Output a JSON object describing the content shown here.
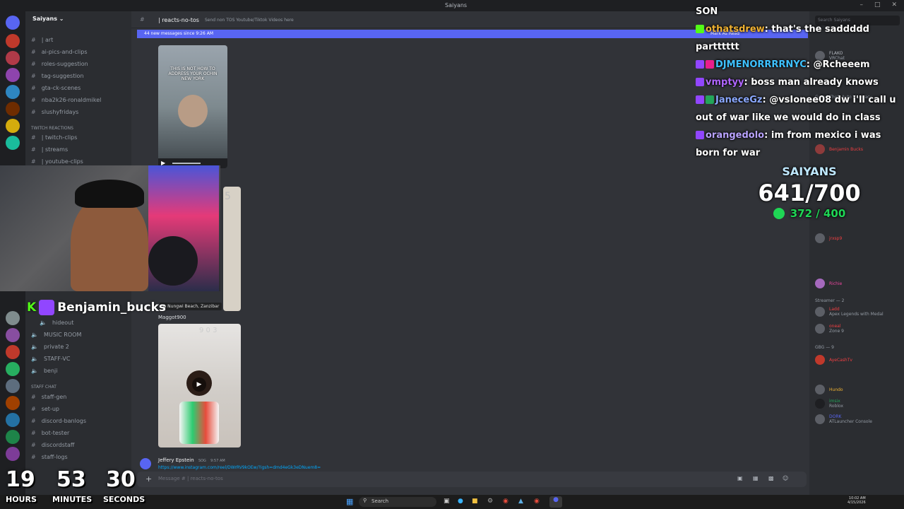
{
  "window": {
    "title": "Saiyans"
  },
  "server": {
    "name": "Saiyans",
    "categories": [
      {
        "label": "Twitch Reactions"
      },
      {
        "label": "STAFF CHAT"
      }
    ],
    "channels_top": [
      {
        "label": "| art"
      },
      {
        "label": "ai-pics-and-clips"
      },
      {
        "label": "roles-suggestion"
      },
      {
        "label": "tag-suggestion"
      },
      {
        "label": "gta-ck-scenes"
      },
      {
        "label": "nba2k26-ronaldmikel"
      },
      {
        "label": "slushyfridays"
      }
    ],
    "channels_twitch": [
      {
        "label": "| twitch-clips"
      },
      {
        "label": "| streams"
      },
      {
        "label": "| youtube-clips"
      }
    ],
    "channels_voice": [
      {
        "label": "hideout"
      },
      {
        "label": "MUSIC ROOM"
      },
      {
        "label": "private 2"
      },
      {
        "label": "STAFF-VC"
      },
      {
        "label": "benji"
      }
    ],
    "channels_staff": [
      {
        "label": "staff-gen"
      },
      {
        "label": "set-up"
      },
      {
        "label": "discord-banlogs"
      },
      {
        "label": "bot-tester"
      },
      {
        "label": "discordstaff"
      },
      {
        "label": "staff-logs"
      }
    ]
  },
  "channel": {
    "name": "| reacts-no-tos",
    "topic": "Send non TOS Youtube/Tiktok Videos here",
    "new_messages": "44 new messages since 9:26 AM",
    "mark_read": "Mark As Read",
    "search_placeholder": "Search Saiyans",
    "input_placeholder": "Message # | reacts-no-tos"
  },
  "messages": [
    {
      "media_caption": "THIS IS NOT HOW TO ADDRESS YOUR OCHIN NEW YORK"
    },
    {
      "location": "Nungwi Beach, Zanzibar",
      "author": "Maggot900"
    },
    {
      "author": "Jeffery Epstein",
      "role": "SOG",
      "time": "9:57 AM",
      "link": "https://www.instagram.com/reel/DWrRV9kOEw/?igsh=dmd4eGk3eDNuem8="
    }
  ],
  "members": {
    "groups": [
      {
        "label": "Streamer — 2"
      },
      {
        "label": "GBG — 9"
      }
    ],
    "list": [
      {
        "name": "FLAKO",
        "status": "VRChat",
        "color": "#b5bac1"
      },
      {
        "name": "Grand Theft Auto V Legacy",
        "status": "",
        "color": "#949ba4"
      },
      {
        "name": "Benjamin Bucks",
        "status": "",
        "color": "#f23f42"
      },
      {
        "name": "jrxsp9",
        "status": "",
        "color": "#f23f42"
      },
      {
        "name": "Richie",
        "status": "",
        "color": "#eb459e"
      },
      {
        "name": "Ladd",
        "status": "Apex Legends with Medal",
        "color": "#f23f42"
      },
      {
        "name": "oneal",
        "status": "Zone 9",
        "color": "#f23f42"
      },
      {
        "name": "AyeCashTv",
        "status": "",
        "color": "#f23f42"
      },
      {
        "name": "Hundo",
        "status": "",
        "color": "#f0b232"
      },
      {
        "name": "imsix",
        "status": "Roblox",
        "color": "#23a55a"
      },
      {
        "name": "DORK",
        "status": "ATLauncher Console",
        "color": "#5865f2"
      }
    ]
  },
  "overlay_chat": {
    "first_line": "SON",
    "messages": [
      {
        "user": "othatsdrew",
        "text": "that's the saddddd partttttt",
        "color": "#f0b232"
      },
      {
        "user": "DJMENORRRRNYC",
        "text": "@Rcheeem",
        "color": "#3ec1ff"
      },
      {
        "user": "vmptyy",
        "text": "boss man already knows",
        "color": "#b066ff"
      },
      {
        "user": "JaneceGz",
        "text": "@vsIonee08 dw i'll call u out of war like we would do in class",
        "color": "#8aa8ff"
      },
      {
        "user": "orangedolo",
        "text": "im from mexico i was born for war",
        "color": "#b9a3ff"
      }
    ]
  },
  "overlay_goal": {
    "label": "SAIYANS",
    "count": "641/700",
    "sub": "372 / 400"
  },
  "streamer": {
    "name": "Benjamin_bucks",
    "prefix": "K"
  },
  "timer": {
    "hours": "19",
    "minutes": "53",
    "seconds": "30",
    "hours_label": "HOURS",
    "minutes_label": "MINUTES",
    "seconds_label": "SECONDS"
  },
  "taskbar": {
    "search": "Search",
    "time": "10:02 AM",
    "date": "4/15/2026"
  },
  "colors": {
    "accent": "#5865f2",
    "twitch": "#9146ff",
    "goal_green": "#1fd655"
  }
}
